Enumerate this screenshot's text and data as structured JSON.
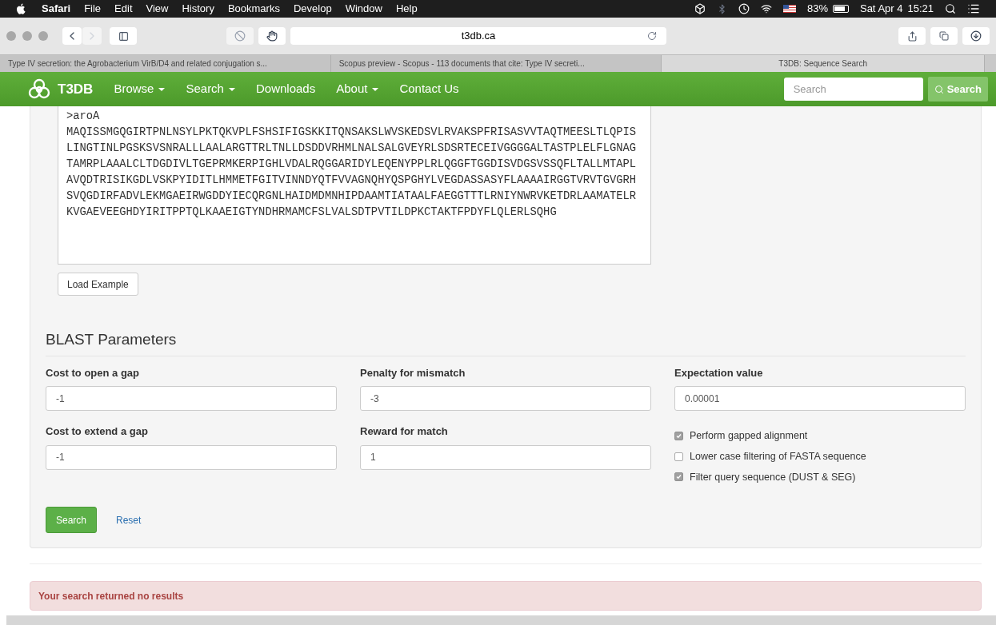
{
  "menu_bar": {
    "items": [
      "Safari",
      "File",
      "Edit",
      "View",
      "History",
      "Bookmarks",
      "Develop",
      "Window",
      "Help"
    ],
    "battery": "83%",
    "date": "Sat Apr 4",
    "time": "15:21"
  },
  "toolbar": {
    "address": "t3db.ca"
  },
  "tabs": [
    {
      "label": "Type IV secretion: the Agrobacterium VirB/D4 and related conjugation s...",
      "selected": false
    },
    {
      "label": "Scopus preview - Scopus - 113 documents that cite: Type IV secreti...",
      "selected": false
    },
    {
      "label": "T3DB: Sequence Search",
      "selected": true
    }
  ],
  "navbar": {
    "brand": "T3DB",
    "items": [
      {
        "label": "Browse",
        "dropdown": true
      },
      {
        "label": "Search",
        "dropdown": true
      },
      {
        "label": "Downloads",
        "dropdown": false
      },
      {
        "label": "About",
        "dropdown": true
      },
      {
        "label": "Contact Us",
        "dropdown": false
      }
    ],
    "search_placeholder": "Search",
    "search_button": "Search"
  },
  "sequence": {
    "lines": [
      ">aroA",
      "MAQISSMGQGIRTPNLNSYLPKTQKVPLFSHSIFIGSKKITQNSAKSLWVSKEDSVLRVAKSPFRISASVVTAQTMEESLTLQPIS",
      "LINGTINLPGSKSVSNRALLLAALARGTTRLTNLLDSDDVRHMLNALSALGVEYRLSDSRTECEIVGGGGALTASTPLELFLGNAG",
      "TAMRPLAAALCLTDGDIVLTGEPRMKERPIGHLVDALRQGGARIDYLEQENYPPLRLQGGFTGGDISVDGSVSSQFLTALLMTAPL",
      "AVQDTRISIKGDLVSKPYIDITLHMMETFGITVINNDYQTFVVAGNQHYQSPGHYLVEGDASSASYFLAAAAIRGGTVRVTGVGRH",
      "SVQGDIRFADVLEKMGAEIRWGDDYIECQRGNLHAIDMDMNHIPDAAMTIATAALFAEGGTTTLRNIYNWRVKETDRLAAMATELR",
      "KVGAEVEEGHDYIRITPPTQLKAAEIGTYNDHRMAMCFSLVALSDTPVTILDPKCTAKTFPDYFLQLERLSQHG"
    ],
    "load_button": "Load Example"
  },
  "blast": {
    "heading": "BLAST Parameters",
    "fields": [
      {
        "label": "Cost to open a gap",
        "value": "-1"
      },
      {
        "label": "Penalty for mismatch",
        "value": "-3"
      },
      {
        "label": "Expectation value",
        "value": "0.00001"
      },
      {
        "label": "Cost to extend a gap",
        "value": "-1"
      },
      {
        "label": "Reward for match",
        "value": "1"
      }
    ],
    "options": [
      {
        "label": "Perform gapped alignment",
        "checked": true
      },
      {
        "label": "Lower case filtering of FASTA sequence",
        "checked": false
      },
      {
        "label": "Filter query sequence (DUST & SEG)",
        "checked": true
      }
    ],
    "search_button": "Search",
    "reset_link": "Reset"
  },
  "alert": "Your search returned no results"
}
